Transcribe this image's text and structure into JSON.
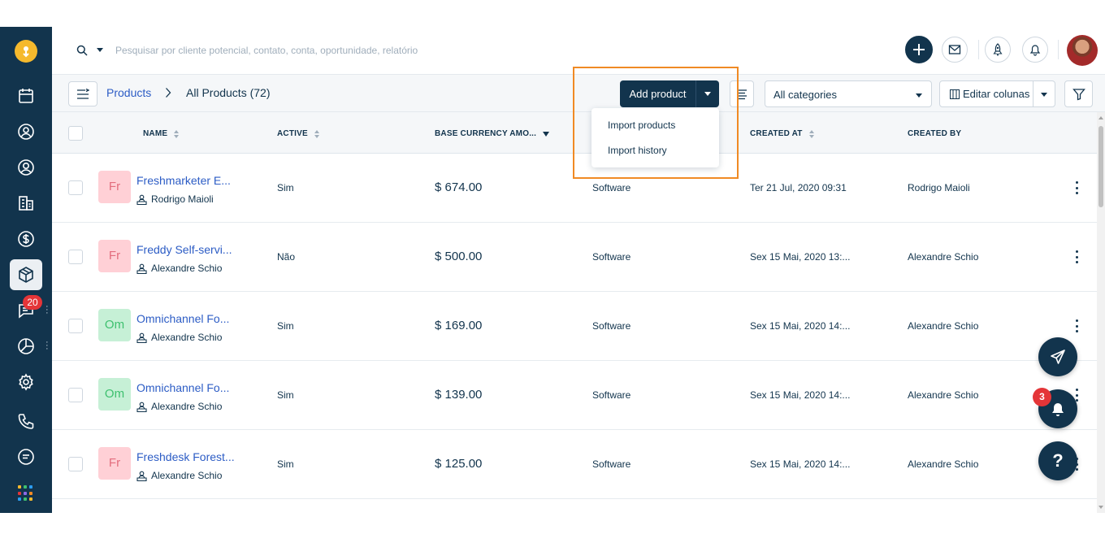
{
  "search": {
    "placeholder": "Pesquisar por cliente potencial, contato, conta, oportunidade, relatório"
  },
  "sidebar": {
    "messages_badge": "20"
  },
  "breadcrumb": {
    "link": "Products",
    "current": "All Products (72)"
  },
  "toolbar": {
    "add_label": "Add product",
    "category_value": "All categories",
    "columns_label": "Editar colunas"
  },
  "add_menu": {
    "items": [
      "Import products",
      "Import history"
    ]
  },
  "columns": {
    "name": "NAME",
    "active": "ACTIVE",
    "amount": "BASE CURRENCY AMO...",
    "created_at": "CREATED AT",
    "created_by": "CREATED BY"
  },
  "rows": [
    {
      "initials": "Fr",
      "name": "Freshmarketer E...",
      "owner": "Rodrigo Maioli",
      "active": "Sim",
      "amount": "$ 674.00",
      "category": "Software",
      "created_at": "Ter 21 Jul, 2020 09:31",
      "created_by": "Rodrigo Maioli"
    },
    {
      "initials": "Fr",
      "name": "Freddy Self-servi...",
      "owner": "Alexandre Schio",
      "active": "Não",
      "amount": "$ 500.00",
      "category": "Software",
      "created_at": "Sex 15 Mai, 2020 13:...",
      "created_by": "Alexandre Schio"
    },
    {
      "initials": "Om",
      "name": "Omnichannel Fo...",
      "owner": "Alexandre Schio",
      "active": "Sim",
      "amount": "$ 169.00",
      "category": "Software",
      "created_at": "Sex 15 Mai, 2020 14:...",
      "created_by": "Alexandre Schio"
    },
    {
      "initials": "Om",
      "name": "Omnichannel Fo...",
      "owner": "Alexandre Schio",
      "active": "Sim",
      "amount": "$ 139.00",
      "category": "Software",
      "created_at": "Sex 15 Mai, 2020 14:...",
      "created_by": "Alexandre Schio"
    },
    {
      "initials": "Fr",
      "name": "Freshdesk Forest...",
      "owner": "Alexandre Schio",
      "active": "Sim",
      "amount": "$ 125.00",
      "category": "Software",
      "created_at": "Sex 15 Mai, 2020 14:...",
      "created_by": "Alexandre Schio"
    }
  ],
  "fabs": {
    "notification_badge": "3",
    "help_label": "?"
  },
  "colors": {
    "sidebar": "#12344d",
    "link": "#2c5cc5",
    "highlight": "#f08a24",
    "badge": "#e43538"
  }
}
